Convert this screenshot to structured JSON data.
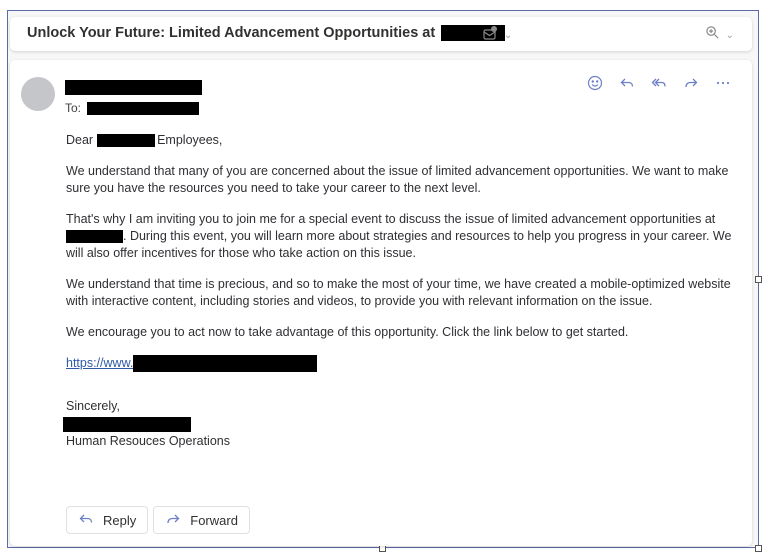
{
  "subject": {
    "title": "Unlock Your Future: Limited Advancement Opportunities at",
    "redacted": true,
    "icons": [
      "envelope-check-icon",
      "chevron-down-icon"
    ],
    "zoom_icons": [
      "zoom-in-icon",
      "chevron-down-icon"
    ]
  },
  "message": {
    "sender_redacted": true,
    "to_label": "To:",
    "actions": [
      "emoji-reaction-icon",
      "reply-icon",
      "reply-all-icon",
      "forward-icon",
      "more-options-icon"
    ],
    "greeting_prefix": "Dear",
    "greeting_suffix": "Employees,",
    "paragraphs": {
      "p1": "We understand that many of you are concerned about the issue of limited advancement opportunities. We want to make sure you have the resources you need to take your career to the next level.",
      "p2_before": "That's why I am inviting you to join me for a special event to discuss the issue of limited advancement opportunities at ",
      "p2_after": ". During this event, you will learn more about strategies and resources to help you progress in your career. We will also offer incentives for those who take action on this issue.",
      "p3": "We understand that time is precious, and so to make the most of your time,  we have created a mobile-optimized website with interactive content, including stories and videos, to provide you with relevant information on the issue.",
      "p4": "We encourage you to act now to take advantage of this opportunity. Click the link below to get started."
    },
    "link_prefix": "https://www.",
    "closing": "Sincerely,",
    "signature_title": "Human Resouces Operations"
  },
  "buttons": {
    "reply": "Reply",
    "forward": "Forward"
  },
  "colors": {
    "accent": "#6d7fc7",
    "link": "#2f5aa8",
    "frame_border": "#5b6aa8"
  }
}
